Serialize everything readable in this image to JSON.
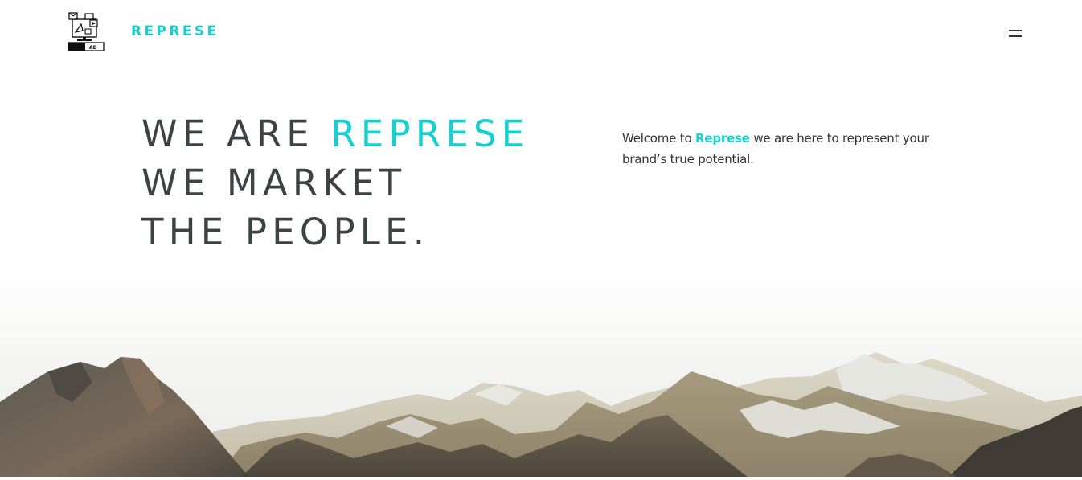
{
  "header": {
    "brand": "REPRESE",
    "logo_icon": "ad-screen-logo-icon",
    "menu_icon": "hamburger-menu-icon"
  },
  "hero": {
    "line1_prefix": "WE ARE ",
    "line1_accent": "REPRESE",
    "line2": "WE MARKET",
    "line3": "THE PEOPLE."
  },
  "intro": {
    "prefix": "Welcome to ",
    "brand": "Represe",
    "suffix": " we are here to represent your brand’s true potential."
  },
  "logo": {
    "badge": "AD"
  },
  "colors": {
    "accent": "#17cfcf",
    "text": "#3d4343"
  }
}
